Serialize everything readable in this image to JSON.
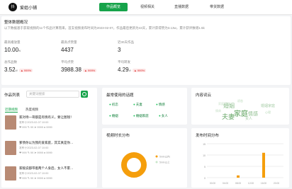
{
  "app": {
    "logo": "抖",
    "name": "爱姐小铺"
  },
  "tabs": [
    "作品概览",
    "视频相关",
    "直播数据",
    "带货数据"
  ],
  "overview": {
    "title": "整体数据概况",
    "note": "以下数据基于获取视频的11个作品计算而来，首支视频发布时间为2023-02-07，作品最后更新为43天，累计获得赞为3.13w，累计获评数增1.5k",
    "metrics_row1": [
      {
        "label": "最高播放量",
        "value": "10.00",
        "unit": "w"
      },
      {
        "label": "最高点赞量",
        "value": "4437",
        "unit": ""
      },
      {
        "label": "近30天作品",
        "value": "3",
        "unit": ""
      }
    ],
    "metrics_row2": [
      {
        "label": "总作品数",
        "value": "3.52",
        "unit": "w",
        "delta": "▲ 999%"
      },
      {
        "label": "平均点赞",
        "value": "3988.38",
        "unit": "",
        "delta": "▲ 999%"
      },
      {
        "label": "平均转发",
        "value": "4.29",
        "unit": "w",
        "delta": "▲ 999%"
      }
    ]
  },
  "works_list": {
    "title": "作品列表",
    "search_placeholder": "关键词搜索",
    "subtabs": [
      "近期视频",
      "热度视频"
    ],
    "items": [
      {
        "title": "家对待一哥都是有情有义，要让图钱！",
        "meta": "发布于2023-02-07 10:00",
        "more": "❤ 999  ✎ 99  ➤ 9999  ● 9999"
      },
      {
        "title": "爹债你以为我的爱家庭，其实真是你…",
        "meta": "发布于2023-02-07 10:00",
        "more": "❤ 999  ✎ 99  ➤ 9999  ● 9999"
      },
      {
        "title": "家敌说都带着两个人身后，女人不累…",
        "meta": "发布于2023-02-07 10:00",
        "more": "❤ 999  ✎ 99  ➤ 9999  ● 9999"
      }
    ]
  },
  "tags_panel": {
    "title": "最常使用的话题",
    "tags": [
      "初恋",
      "夫妻",
      "情感",
      "婚姻",
      "婚姻家庭",
      "女人"
    ]
  },
  "wordcloud": {
    "title": "内容词云",
    "words": [
      "婚姻",
      "家庭",
      "夫妻",
      "情感",
      "女人",
      "婚姻家庭",
      "初恋",
      "心理",
      "家庭情感",
      "情商"
    ]
  },
  "duration": {
    "title": "视频时长分布",
    "legend": [
      "5min以内",
      "5min以上"
    ],
    "center_label": "视频时长"
  },
  "time_dist": {
    "title": "发布时间分布",
    "y_ticks": [
      "15",
      "10",
      "5",
      "0"
    ],
    "x_labels": [
      "00:00",
      "04:00",
      "08:00",
      "12:00",
      "16:00",
      "20:00"
    ]
  },
  "chart_data": [
    {
      "type": "pie",
      "categories": [
        "5min以内",
        "5min以上"
      ],
      "values": [
        1,
        0
      ]
    },
    {
      "type": "bar",
      "categories": [
        "00:00",
        "04:00",
        "08:00",
        "12:00",
        "16:00",
        "20:00"
      ],
      "values": [
        0,
        0,
        1,
        0,
        11,
        0
      ],
      "ylim": [
        0,
        15
      ]
    }
  ],
  "colors": {
    "accent": "#16a34a",
    "pie": "#f59e0b",
    "bar": "#f59e0b"
  }
}
